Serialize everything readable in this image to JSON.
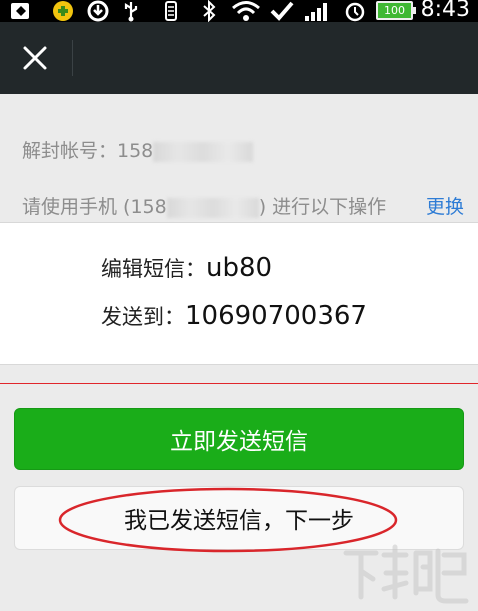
{
  "status_bar": {
    "time": "8:43",
    "battery": "100",
    "icons": [
      "notification-icon",
      "app-icon",
      "sync-icon",
      "usb-icon",
      "signal-tool-icon",
      "bluetooth-icon",
      "wifi-icon",
      "check-icon",
      "cell-signal-icon",
      "alarm-icon",
      "battery-icon"
    ]
  },
  "title_bar": {
    "close_icon": "close-icon"
  },
  "info": {
    "account_label": "解封帐号：158",
    "phone_prefix": "请使用手机 (158",
    "phone_suffix": ") 进行以下操作",
    "change_link": "更换"
  },
  "sms": {
    "edit_label": "编辑短信：",
    "edit_value": "ub80",
    "send_to_label": "发送到：",
    "send_to_value": "10690700367"
  },
  "buttons": {
    "send_now": "立即发送短信",
    "sent_next": "我已发送短信，下一步"
  },
  "colors": {
    "title_bar_bg": "#22282a",
    "primary_green": "#1aad19",
    "link_blue": "#2e7cd5",
    "annotation_red": "#d9262b"
  }
}
